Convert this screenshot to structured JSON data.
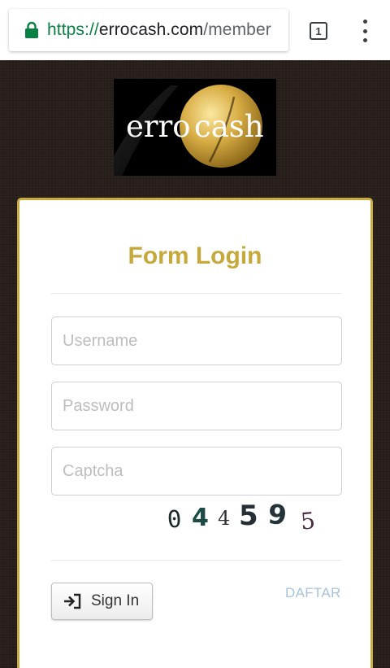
{
  "browser": {
    "url_scheme": "https://",
    "url_host": "errocash.com",
    "url_path": "/member",
    "tab_count": "1",
    "lock_icon": "lock-icon",
    "menu_icon": "kebab-menu-icon",
    "colors": {
      "secure": "#0b8043",
      "toolbar": "#ffffff"
    }
  },
  "logo": {
    "text_left": "erro",
    "text_right": "cash",
    "colors": {
      "gold": "#d2a83a",
      "background": "#000000"
    }
  },
  "login": {
    "title": "Form Login",
    "username_placeholder": "Username",
    "password_placeholder": "Password",
    "captcha_placeholder": "Captcha",
    "captcha_digits": [
      "0",
      "4",
      "4",
      "5",
      "9",
      "5"
    ],
    "signin_label": "Sign In",
    "signin_icon": "sign-in-icon",
    "register_label": "DAFTAR",
    "colors": {
      "title": "#c7a83b",
      "border": "#c9aa3c",
      "link": "#a9c3dc"
    }
  }
}
